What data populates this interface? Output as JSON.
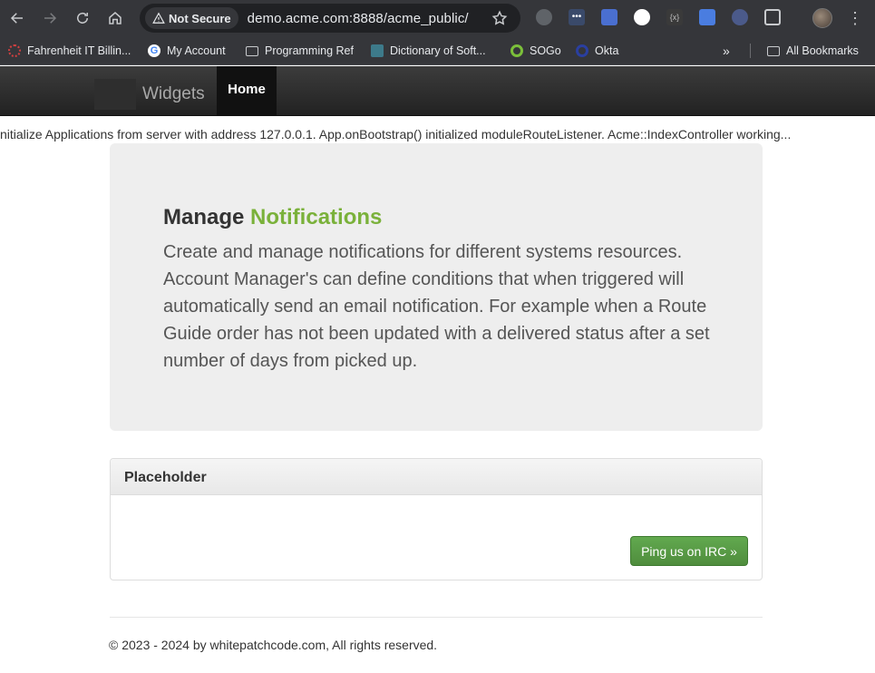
{
  "browser": {
    "security_label": "Not Secure",
    "url": "demo.acme.com:8888/acme_public/",
    "bookmarks": [
      {
        "label": "Fahrenheit IT Billin...",
        "icon": "red-circle-icon"
      },
      {
        "label": "My Account",
        "icon": "google-icon"
      },
      {
        "label": "Programming Ref",
        "icon": "folder-icon"
      },
      {
        "label": "Dictionary of Soft...",
        "icon": "book-icon"
      },
      {
        "label": "SOGo",
        "icon": "sogo-icon"
      },
      {
        "label": "Okta",
        "icon": "okta-icon"
      }
    ],
    "more_bookmarks": "»",
    "all_bookmarks": "All Bookmarks"
  },
  "navbar": {
    "brand": "Widgets",
    "home": "Home"
  },
  "log_line": "nitialize Applications from server with address 127.0.0.1. App.onBootstrap() initialized moduleRouteListener. Acme::IndexController working...",
  "hero": {
    "title_prefix": "Manage",
    "title_accent": "Notifications",
    "body": "Create and manage notifications for different systems resources. Account Manager's can define conditions that when triggered will automatically send an email notification. For example when a Route Guide order has not been updated with a delivered status after a set number of days from picked up."
  },
  "panel": {
    "heading": "Placeholder",
    "button": "Ping us on IRC »"
  },
  "footer": {
    "text": "© 2023 - 2024 by whitepatchcode.com, All rights reserved."
  },
  "colors": {
    "accent_green": "#7ab13a",
    "button_green": "#5a9e48",
    "navbar_dark": "#222222"
  }
}
